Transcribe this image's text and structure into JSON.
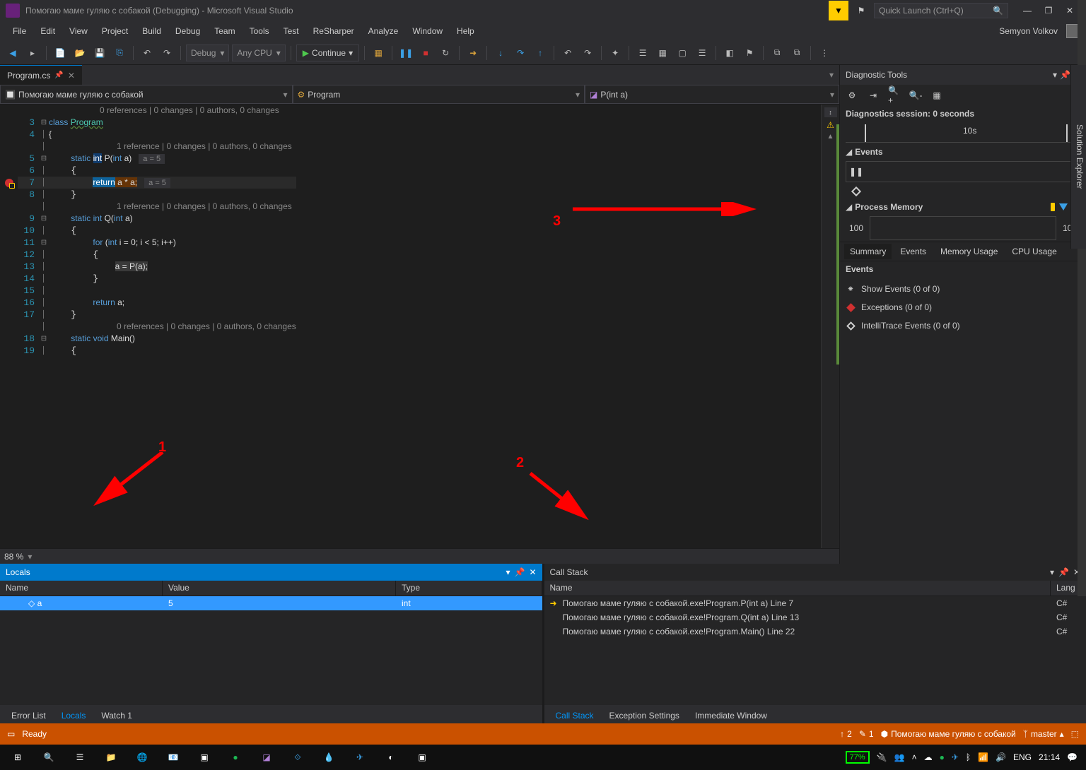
{
  "title": "Помогаю маме гуляю с собакой (Debugging) - Microsoft Visual Studio",
  "quickLaunch": "Quick Launch (Ctrl+Q)",
  "menu": [
    "File",
    "Edit",
    "View",
    "Project",
    "Build",
    "Debug",
    "Team",
    "Tools",
    "Test",
    "ReSharper",
    "Analyze",
    "Window",
    "Help"
  ],
  "user": "Semyon Volkov",
  "toolbar": {
    "config": "Debug",
    "platform": "Any CPU",
    "continue": "Continue"
  },
  "fileTab": "Program.cs",
  "nav": {
    "ns": "Помогаю маме гуляю с собакой",
    "cls": "Program",
    "member": "P(int a)"
  },
  "code": {
    "lens1": "0 references | 0 changes | 0 authors, 0 changes",
    "l3": {
      "no": "3",
      "t1": "class ",
      "t2": "Program"
    },
    "l4": {
      "no": "4",
      "t": "{"
    },
    "lens2": "1 reference | 0 changes | 0 authors, 0 changes",
    "l5": {
      "no": "5",
      "s": "static ",
      "i": "int",
      "sp": " P(",
      "i2": "int",
      "a": " a)",
      "hint": "a = 5"
    },
    "l6": {
      "no": "6",
      "t": "{"
    },
    "l7": {
      "no": "7",
      "r": "return",
      "expr": " a * a;",
      "hint": "a = 5"
    },
    "l8": {
      "no": "8",
      "t": "}"
    },
    "lens3": "1 reference | 0 changes | 0 authors, 0 changes",
    "l9": {
      "no": "9",
      "s": "static ",
      "i": "int",
      "sp": " Q(",
      "i2": "int",
      "a": " a)"
    },
    "l10": {
      "no": "10",
      "t": "{"
    },
    "l11": {
      "no": "11",
      "f": "for",
      "p": " (",
      "i": "int",
      "rest": " i = 0; i < 5; i++)"
    },
    "l12": {
      "no": "12",
      "t": "{"
    },
    "l13": {
      "no": "13",
      "t": "a = P(a);"
    },
    "l14": {
      "no": "14",
      "t": "}"
    },
    "l15": {
      "no": "15"
    },
    "l16": {
      "no": "16",
      "r": "return",
      "a": " a;"
    },
    "l17": {
      "no": "17",
      "t": "}"
    },
    "lens4": "0 references | 0 changes | 0 authors, 0 changes",
    "l18": {
      "no": "18",
      "s": "static ",
      "v": "void",
      "m": " Main()"
    },
    "l19": {
      "no": "19",
      "t": "{"
    }
  },
  "zoom": "88 %",
  "diag": {
    "title": "Diagnostic Tools",
    "session": "Diagnostics session: 0 seconds",
    "timeMark": "10s",
    "events": "Events",
    "procmem": "Process Memory",
    "memval": "100",
    "tabs": [
      "Summary",
      "Events",
      "Memory Usage",
      "CPU Usage"
    ],
    "evHdr": "Events",
    "ev1": "Show Events (0 of 0)",
    "ev2": "Exceptions (0 of 0)",
    "ev3": "IntelliTrace Events (0 of 0)"
  },
  "locals": {
    "title": "Locals",
    "cols": {
      "name": "Name",
      "value": "Value",
      "type": "Type"
    },
    "row": {
      "name": "a",
      "value": "5",
      "type": "int"
    },
    "tabs": [
      "Error List",
      "Locals",
      "Watch 1"
    ]
  },
  "callstack": {
    "title": "Call Stack",
    "cols": {
      "name": "Name",
      "lang": "Lang"
    },
    "rows": [
      {
        "name": "Помогаю маме гуляю с собакой.exe!Program.P(int a) Line 7",
        "lang": "C#"
      },
      {
        "name": "Помогаю маме гуляю с собакой.exe!Program.Q(int a) Line 13",
        "lang": "C#"
      },
      {
        "name": "Помогаю маме гуляю с собакой.exe!Program.Main() Line 22",
        "lang": "C#"
      }
    ],
    "tabs": [
      "Call Stack",
      "Exception Settings",
      "Immediate Window"
    ]
  },
  "status": {
    "ready": "Ready",
    "up": "2",
    "edit": "1",
    "proj": "Помогаю маме гуляю с собакой",
    "branch": "master"
  },
  "solexp": "Solution Explorer",
  "tray": {
    "battery": "77%",
    "lang": "ENG",
    "time": "21:14"
  },
  "anno": {
    "a1": "1",
    "a2": "2",
    "a3": "3"
  }
}
